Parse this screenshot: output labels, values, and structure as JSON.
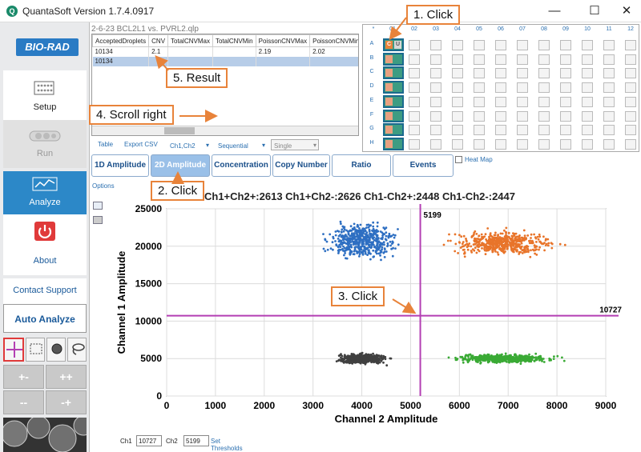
{
  "app": {
    "title": "QuantaSoft Version 1.7.4.0917",
    "logo_letter": "Q",
    "controls": {
      "minimize": "—",
      "maximize": "☐",
      "close": "✕"
    }
  },
  "sidebar": {
    "brand": "BIO-RAD",
    "setup_label": "Setup",
    "run_label": "Run",
    "analyze_label": "Analyze",
    "about_label": "About",
    "contact_label": "Contact Support",
    "auto_analyze_label": "Auto Analyze",
    "quadrant_buttons": [
      "+-",
      "++",
      "--",
      "-+"
    ]
  },
  "file": {
    "name": "2-6-23 BCL2L1 vs. PVRL2.qlp"
  },
  "results_table": {
    "columns": [
      "AcceptedDroplets",
      "CNV",
      "TotalCNVMax",
      "TotalCNVMin",
      "PoissonCNVMax",
      "PoissonCNVMin"
    ],
    "rows": [
      [
        "10134",
        "2.1",
        "",
        "",
        "2.19",
        "2.02"
      ],
      [
        "10134",
        "",
        "",
        "",
        "",
        ""
      ]
    ]
  },
  "table_bar": {
    "table_link": "Table",
    "export_link": "Export CSV",
    "channel_select": "Ch1,Ch2",
    "mode_select": "Sequential",
    "single_select": "Single"
  },
  "plate": {
    "corner": "*",
    "columns": [
      "01",
      "02",
      "03",
      "04",
      "05",
      "06",
      "07",
      "08",
      "09",
      "10",
      "11",
      "12"
    ],
    "rows": [
      "A",
      "B",
      "C",
      "D",
      "E",
      "F",
      "G",
      "H"
    ],
    "well_a01_labels": [
      "C",
      "U"
    ],
    "heat_map_label": "Heat Map"
  },
  "tabs": [
    "1D Amplitude",
    "2D Amplitude",
    "Concentration",
    "Copy Number",
    "Ratio",
    "Events"
  ],
  "options_label": "Options",
  "chart_header": "Ch1+Ch2+:2613  Ch1+Ch2-:2626  Ch1-Ch2+:2448  Ch1-Ch2-:2447",
  "chart_data": {
    "type": "scatter",
    "xlabel": "Channel 2 Amplitude",
    "ylabel": "Channel 1 Amplitude",
    "xlim": [
      0,
      9000
    ],
    "ylim": [
      0,
      25000
    ],
    "xticks": [
      0,
      1000,
      2000,
      3000,
      4000,
      5000,
      6000,
      7000,
      8000,
      9000
    ],
    "yticks": [
      0,
      5000,
      10000,
      15000,
      20000,
      25000
    ],
    "grid": true,
    "threshold_x": 5199,
    "threshold_y": 10727,
    "threshold_x_label": "5199",
    "threshold_y_label": "10727",
    "clusters": [
      {
        "name": "Ch1+Ch2-",
        "color": "#2e6fc2",
        "center": [
          4000,
          20700
        ],
        "spread": [
          300,
          1000
        ]
      },
      {
        "name": "Ch1+Ch2+",
        "color": "#e8742a",
        "center": [
          6900,
          20400
        ],
        "spread": [
          450,
          700
        ]
      },
      {
        "name": "Ch1-Ch2-",
        "color": "#404040",
        "center": [
          4000,
          5000
        ],
        "spread": [
          220,
          300
        ]
      },
      {
        "name": "Ch1-Ch2+",
        "color": "#3aaa35",
        "center": [
          6900,
          5000
        ],
        "spread": [
          420,
          250
        ]
      }
    ]
  },
  "thresholds": {
    "ch1_label": "Ch1",
    "ch1_value": "10727",
    "ch2_label": "Ch2",
    "ch2_value": "5199",
    "set_link": "Set Thresholds"
  },
  "callouts": {
    "step1": "1. Click",
    "step2": "2. Click",
    "step3": "3. Click",
    "step4": "4. Scroll right",
    "step5": "5. Result"
  },
  "colors": {
    "accent": "#2c88c8",
    "callout_border": "#e8833a",
    "threshold_line": "#b33fb3"
  }
}
